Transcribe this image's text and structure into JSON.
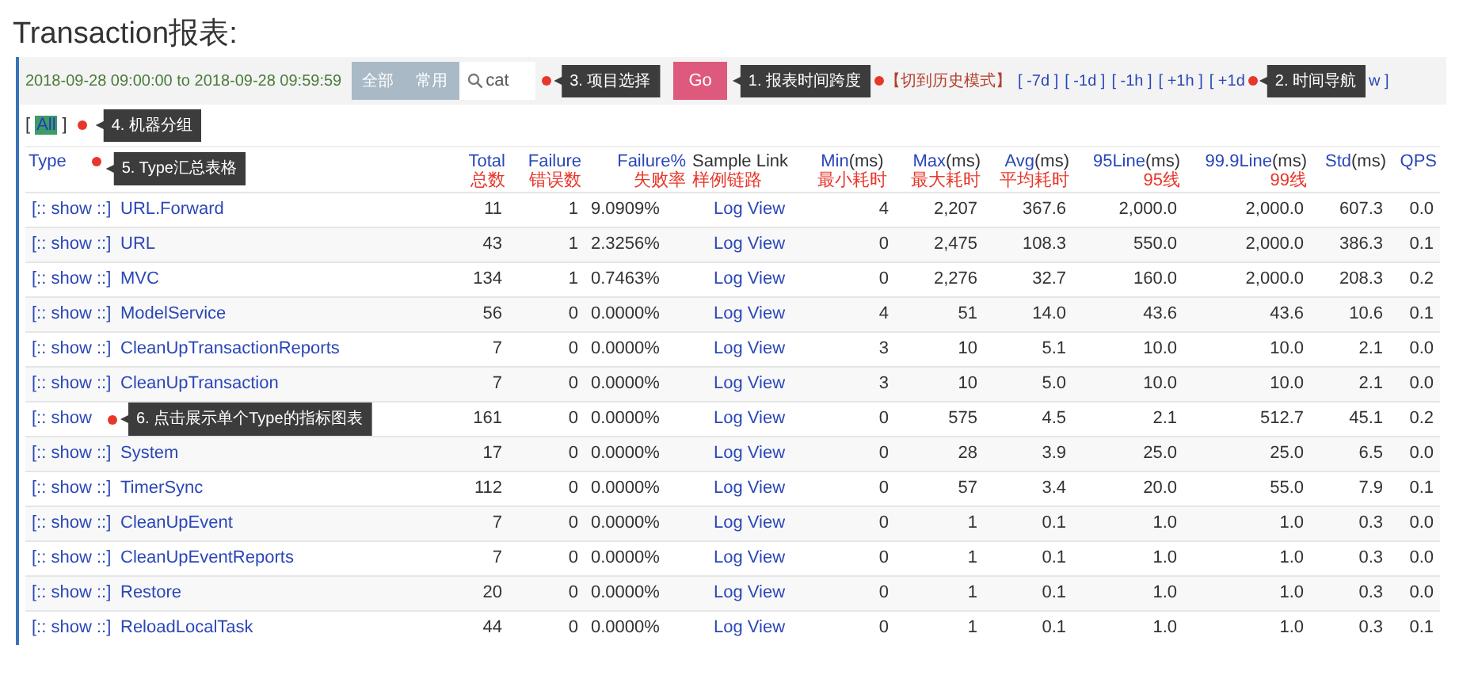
{
  "title": "Transaction报表:",
  "toolbar": {
    "time_range": "2018-09-28 09:00:00 to 2018-09-28 09:59:59",
    "scope_buttons": [
      "全部",
      "常用"
    ],
    "search": {
      "value": "cat"
    },
    "callout_project": "3. 项目选择",
    "go_button": "Go",
    "callout_range": "1. 报表时间跨度",
    "history_link": "【切到历史模式】",
    "nav_links": [
      "[ -7d ]",
      "[ -1d ]",
      "[ -1h ]",
      "[ +1h ]",
      "[ +1d"
    ],
    "callout_nav": "2. 时间导航",
    "nav_tail": "w ]"
  },
  "machine_groups": {
    "bracket_open": "[",
    "items": [
      {
        "label": "All",
        "selected": true
      }
    ],
    "bracket_close": "]",
    "callout": "4. 机器分组"
  },
  "table": {
    "callout": "5. Type汇总表格",
    "columns": [
      {
        "label": "Type",
        "sortable": true
      },
      {
        "label": "Total",
        "sortable": true,
        "note": "总数"
      },
      {
        "label": "Failure",
        "sortable": true,
        "note": "错误数"
      },
      {
        "label": "Failure%",
        "sortable": true,
        "note": "失败率"
      },
      {
        "label": "Sample Link",
        "sortable": false,
        "note": "样例链路"
      },
      {
        "label": "Min",
        "unit": "(ms)",
        "sortable": true,
        "note": "最小耗时"
      },
      {
        "label": "Max",
        "unit": "(ms)",
        "sortable": true,
        "note": "最大耗时"
      },
      {
        "label": "Avg",
        "unit": "(ms)",
        "sortable": true,
        "note": "平均耗时"
      },
      {
        "label": "95Line",
        "unit": "(ms)",
        "sortable": true,
        "note": "95线"
      },
      {
        "label": "99.9Line",
        "unit": "(ms)",
        "sortable": true,
        "note": "99线"
      },
      {
        "label": "Std",
        "unit": "(ms)",
        "sortable": true
      },
      {
        "label": "QPS",
        "sortable": true
      }
    ],
    "rows": [
      {
        "show": "[:: show ::]",
        "name": "URL.Forward",
        "total": "11",
        "failure": "1",
        "failure_pct": "9.0909%",
        "sample": "Log View",
        "min": "4",
        "max": "2,207",
        "avg": "367.6",
        "l95": "2,000.0",
        "l999": "2,000.0",
        "std": "607.3",
        "qps": "0.0"
      },
      {
        "show": "[:: show ::]",
        "name": "URL",
        "total": "43",
        "failure": "1",
        "failure_pct": "2.3256%",
        "sample": "Log View",
        "min": "0",
        "max": "2,475",
        "avg": "108.3",
        "l95": "550.0",
        "l999": "2,000.0",
        "std": "386.3",
        "qps": "0.1"
      },
      {
        "show": "[:: show ::]",
        "name": "MVC",
        "total": "134",
        "failure": "1",
        "failure_pct": "0.7463%",
        "sample": "Log View",
        "min": "0",
        "max": "2,276",
        "avg": "32.7",
        "l95": "160.0",
        "l999": "2,000.0",
        "std": "208.3",
        "qps": "0.2"
      },
      {
        "show": "[:: show ::]",
        "name": "ModelService",
        "total": "56",
        "failure": "0",
        "failure_pct": "0.0000%",
        "sample": "Log View",
        "min": "4",
        "max": "51",
        "avg": "14.0",
        "l95": "43.6",
        "l999": "43.6",
        "std": "10.6",
        "qps": "0.1"
      },
      {
        "show": "[:: show ::]",
        "name": "CleanUpTransactionReports",
        "total": "7",
        "failure": "0",
        "failure_pct": "0.0000%",
        "sample": "Log View",
        "min": "3",
        "max": "10",
        "avg": "5.1",
        "l95": "10.0",
        "l999": "10.0",
        "std": "2.1",
        "qps": "0.0"
      },
      {
        "show": "[:: show ::]",
        "name": "CleanUpTransaction",
        "total": "7",
        "failure": "0",
        "failure_pct": "0.0000%",
        "sample": "Log View",
        "min": "3",
        "max": "10",
        "avg": "5.0",
        "l95": "10.0",
        "l999": "10.0",
        "std": "2.1",
        "qps": "0.0"
      },
      {
        "show": "[:: show",
        "callout": "6. 点击展示单个Type的指标图表",
        "total": "161",
        "failure": "0",
        "failure_pct": "0.0000%",
        "sample": "Log View",
        "min": "0",
        "max": "575",
        "avg": "4.5",
        "l95": "2.1",
        "l999": "512.7",
        "std": "45.1",
        "qps": "0.2"
      },
      {
        "show": "[:: show ::]",
        "name": "System",
        "total": "17",
        "failure": "0",
        "failure_pct": "0.0000%",
        "sample": "Log View",
        "min": "0",
        "max": "28",
        "avg": "3.9",
        "l95": "25.0",
        "l999": "25.0",
        "std": "6.5",
        "qps": "0.0"
      },
      {
        "show": "[:: show ::]",
        "name": "TimerSync",
        "total": "112",
        "failure": "0",
        "failure_pct": "0.0000%",
        "sample": "Log View",
        "min": "0",
        "max": "57",
        "avg": "3.4",
        "l95": "20.0",
        "l999": "55.0",
        "std": "7.9",
        "qps": "0.1"
      },
      {
        "show": "[:: show ::]",
        "name": "CleanUpEvent",
        "total": "7",
        "failure": "0",
        "failure_pct": "0.0000%",
        "sample": "Log View",
        "min": "0",
        "max": "1",
        "avg": "0.1",
        "l95": "1.0",
        "l999": "1.0",
        "std": "0.3",
        "qps": "0.0"
      },
      {
        "show": "[:: show ::]",
        "name": "CleanUpEventReports",
        "total": "7",
        "failure": "0",
        "failure_pct": "0.0000%",
        "sample": "Log View",
        "min": "0",
        "max": "1",
        "avg": "0.1",
        "l95": "1.0",
        "l999": "1.0",
        "std": "0.3",
        "qps": "0.0"
      },
      {
        "show": "[:: show ::]",
        "name": "Restore",
        "total": "20",
        "failure": "0",
        "failure_pct": "0.0000%",
        "sample": "Log View",
        "min": "0",
        "max": "1",
        "avg": "0.1",
        "l95": "1.0",
        "l999": "1.0",
        "std": "0.3",
        "qps": "0.0"
      },
      {
        "show": "[:: show ::]",
        "name": "ReloadLocalTask",
        "total": "44",
        "failure": "0",
        "failure_pct": "0.0000%",
        "sample": "Log View",
        "min": "0",
        "max": "1",
        "avg": "0.1",
        "l95": "1.0",
        "l999": "1.0",
        "std": "0.3",
        "qps": "0.1"
      }
    ]
  }
}
